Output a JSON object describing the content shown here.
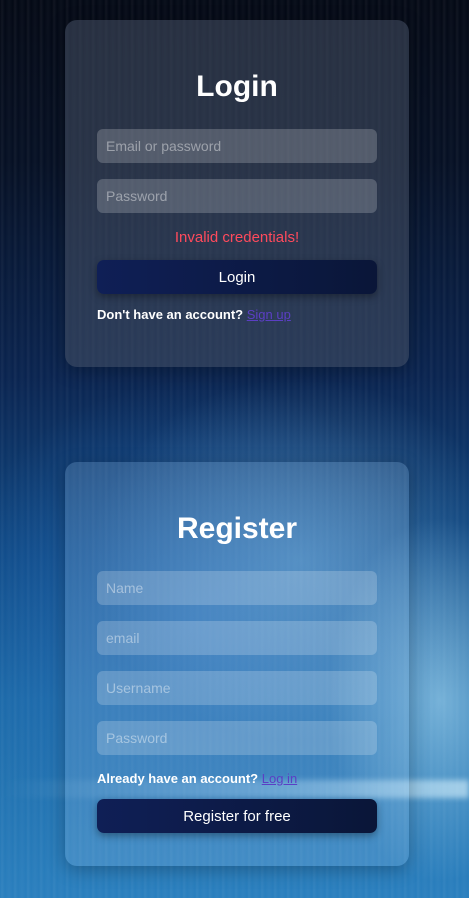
{
  "login": {
    "title": "Login",
    "email_placeholder": "Email or password",
    "password_placeholder": "Password",
    "error": "Invalid credentials!",
    "submit_label": "Login",
    "switch_prompt": "Don't have an account?",
    "switch_link": "Sign up"
  },
  "register": {
    "title": "Register",
    "name_placeholder": "Name",
    "email_placeholder": "email",
    "username_placeholder": "Username",
    "password_placeholder": "Password",
    "switch_prompt": "Already have an account?",
    "switch_link": "Log in",
    "submit_label": "Register for free"
  },
  "colors": {
    "error": "#ff4a5c",
    "button": "#0f1f56",
    "link": "#5b3fc4"
  }
}
